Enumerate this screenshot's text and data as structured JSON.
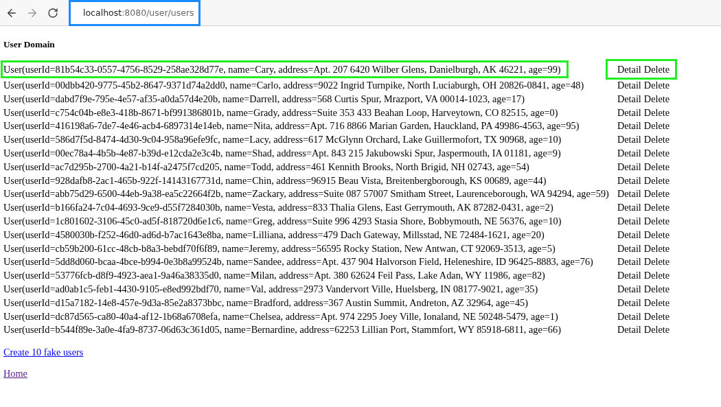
{
  "browser": {
    "url_host": "localhost",
    "url_path": ":8080/user/users",
    "url_highlighted": true
  },
  "heading": "User Domain",
  "rows": [
    {
      "text": "User(userId=81b54c33-0557-4756-8529-258ae328d77e, name=Cary, address=Apt. 207 6420 Wilber Glens, Danielburgh, AK 46221, age=99)",
      "detail": "Detail",
      "delete": "Delete",
      "highlighted": true
    },
    {
      "text": "User(userId=00dbb420-9775-45b2-8647-9371d74a2dd0, name=Carlo, address=9022 Ingrid Turnpike, North Luciaburgh, OH 20826-0841, age=48)",
      "detail": "Detail",
      "delete": "Delete",
      "highlighted": false
    },
    {
      "text": "User(userId=dabd7f9e-795e-4e57-af35-a0da57d4e20b, name=Darrell, address=568 Curtis Spur, Mrazport, VA 00014-1023, age=17)",
      "detail": "Detail",
      "delete": "Delete",
      "highlighted": false
    },
    {
      "text": "User(userId=c754c04b-e8e3-418b-8671-bf991386801b, name=Grady, address=Suite 353 433 Beahan Loop, Harveytown, CO 82515, age=0)",
      "detail": "Detail",
      "delete": "Delete",
      "highlighted": false
    },
    {
      "text": "User(userId=416198a6-7de7-4e46-acb4-6897314e14eb, name=Nita, address=Apt. 716 8866 Marian Garden, Hauckland, PA 49986-4563, age=95)",
      "detail": "Detail",
      "delete": "Delete",
      "highlighted": false
    },
    {
      "text": "User(userId=586d7f5d-8474-4d30-9c04-958a96efe9fc, name=Lacy, address=617 McGlynn Orchard, Lake Guillermofort, TX 90968, age=10)",
      "detail": "Detail",
      "delete": "Delete",
      "highlighted": false
    },
    {
      "text": "User(userId=00ec78a4-4b5b-4e87-b39d-e12cda2e3c4b, name=Shad, address=Apt. 843 215 Jakubowski Spur, Jaspermouth, IA 01181, age=9)",
      "detail": "Detail",
      "delete": "Delete",
      "highlighted": false
    },
    {
      "text": "User(userId=ac7d295b-2700-4a21-b14f-a2475f7cd205, name=Todd, address=461 Kennith Brooks, North Brigid, NH 02743, age=54)",
      "detail": "Detail",
      "delete": "Delete",
      "highlighted": false
    },
    {
      "text": "User(userId=928dafb8-2ac1-465b-922f-14143167731d, name=Chin, address=96915 Beau Vista, Breitenbergborough, KS 00689, age=44)",
      "detail": "Detail",
      "delete": "Delete",
      "highlighted": false
    },
    {
      "text": "User(userId=abb75d29-6500-44eb-9a38-ea5c22664f2b, name=Zackary, address=Suite 087 57007 Smitham Street, Laurenceborough, WA 94294, age=59)",
      "detail": "Detail",
      "delete": "Delete",
      "highlighted": false
    },
    {
      "text": "User(userId=b166fa24-7c04-4693-9ce9-d55f7284030b, name=Vesta, address=833 Thalia Glens, East Gerrymouth, AK 87282-0431, age=2)",
      "detail": "Detail",
      "delete": "Delete",
      "highlighted": false
    },
    {
      "text": "User(userId=1c801602-3106-45c0-ad5f-818720d6e1c6, name=Greg, address=Suite 996 4293 Stasia Shore, Bobbymouth, NE 56376, age=10)",
      "detail": "Detail",
      "delete": "Delete",
      "highlighted": false
    },
    {
      "text": "User(userId=4580030b-f252-46d0-ad6d-b7ac1643e8ba, name=Lilliana, address=479 Dach Gateway, Millsstad, NE 72484-1621, age=20)",
      "detail": "Detail",
      "delete": "Delete",
      "highlighted": false
    },
    {
      "text": "User(userId=cb59b200-61cc-48cb-b8a3-bebdf70f6f89, name=Jeremy, address=56595 Rocky Station, New Antwan, CT 92069-3513, age=5)",
      "detail": "Detail",
      "delete": "Delete",
      "highlighted": false
    },
    {
      "text": "User(userId=5dd8d060-bcaa-4bce-b994-0e3b8a99524b, name=Sandee, address=Apt. 437 904 Halvorson Field, Heleneshire, ID 96425-8883, age=76)",
      "detail": "Detail",
      "delete": "Delete",
      "highlighted": false
    },
    {
      "text": "User(userId=53776fcb-d8f9-4923-aea1-9a46a38335d0, name=Milan, address=Apt. 380 62624 Feil Pass, Lake Adan, WY 11986, age=82)",
      "detail": "Detail",
      "delete": "Delete",
      "highlighted": false
    },
    {
      "text": "User(userId=ad0ab1c5-feb1-4430-9105-e8ed992bdf70, name=Val, address=2973 Vandervort Ville, Huelsberg, IN 08177-9021, age=35)",
      "detail": "Detail",
      "delete": "Delete",
      "highlighted": false
    },
    {
      "text": "User(userId=d15a7182-14e8-457e-9d3a-85e2a8373bbc, name=Bradford, address=367 Austin Summit, Andreton, AZ 32964, age=45)",
      "detail": "Detail",
      "delete": "Delete",
      "highlighted": false
    },
    {
      "text": "User(userId=dc87d565-ca80-40a4-af12-1b68a6708efa, name=Chelsea, address=Apt. 974 2295 Joey Ville, Ionaland, NE 50248-5479, age=1)",
      "detail": "Detail",
      "delete": "Delete",
      "highlighted": false
    },
    {
      "text": "User(userId=b544f89e-3a0e-4fa9-8737-06d63c361d05, name=Bernardine, address=62253 Lillian Port, Stammfort, WY 85918-6811, age=66)",
      "detail": "Detail",
      "delete": "Delete",
      "highlighted": false
    }
  ],
  "links": [
    {
      "label": "Create 10 fake users",
      "visited": false
    },
    {
      "label": "Home",
      "visited": true
    }
  ]
}
